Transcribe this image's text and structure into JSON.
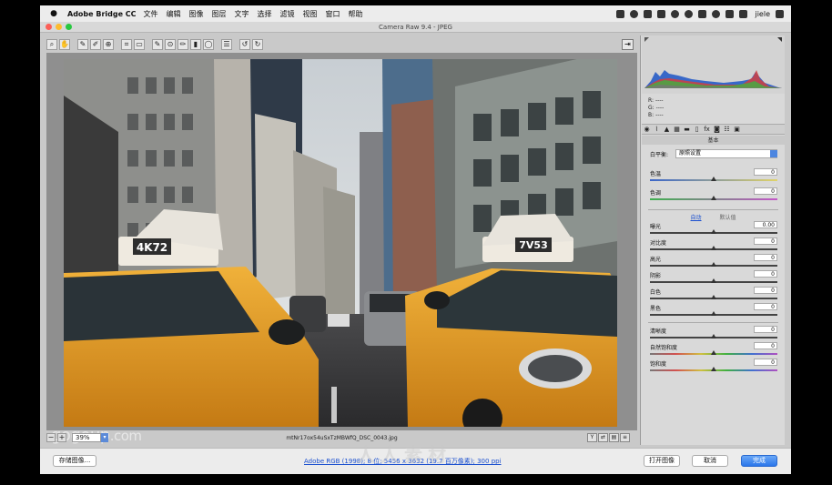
{
  "menubar": {
    "apple": "",
    "app_name": "Adobe Bridge CC",
    "items": [
      "文件",
      "编辑",
      "图像",
      "图层",
      "文字",
      "选择",
      "滤镜",
      "视图",
      "窗口",
      "帮助"
    ],
    "user": "jiele"
  },
  "window": {
    "title": "Camera Raw 9.4 - JPEG"
  },
  "toolbar": {
    "tools": [
      "zoom-tool-icon",
      "hand-tool-icon",
      "white-balance-icon",
      "color-sampler-icon",
      "target-adjust-icon",
      "crop-icon",
      "straighten-icon",
      "spot-removal-icon",
      "red-eye-icon",
      "adjustment-brush-icon",
      "graduated-filter-icon",
      "radial-filter-icon",
      "preferences-icon",
      "rotate-ccw-icon",
      "rotate-cw-icon"
    ],
    "toggle_fullscreen": "⇥"
  },
  "status": {
    "zoom_value": "39%",
    "filename": "mtNr17ox54uSxTzMBWfQ_DSC_0043.jpg"
  },
  "histogram": {
    "r_label": "R:",
    "r_value": "----",
    "g_label": "G:",
    "g_value": "----",
    "b_label": "B:",
    "b_value": "----"
  },
  "panel": {
    "section_title": "基本",
    "wb_label": "白平衡:",
    "wb_value": "原照设置",
    "temperature_label": "色温",
    "temperature_value": "0",
    "temperature_pos": 0.5,
    "tint_label": "色调",
    "tint_value": "0",
    "tint_pos": 0.5,
    "auto_label": "自动",
    "default_label": "默认值",
    "exposure_label": "曝光",
    "exposure_value": "0.00",
    "exposure_pos": 0.5,
    "contrast_label": "对比度",
    "contrast_value": "0",
    "contrast_pos": 0.5,
    "highlights_label": "高光",
    "highlights_value": "0",
    "highlights_pos": 0.5,
    "shadows_label": "阴影",
    "shadows_value": "0",
    "shadows_pos": 0.5,
    "whites_label": "白色",
    "whites_value": "0",
    "whites_pos": 0.5,
    "blacks_label": "黑色",
    "blacks_value": "0",
    "blacks_pos": 0.5,
    "clarity_label": "清晰度",
    "clarity_value": "0",
    "clarity_pos": 0.5,
    "vibrance_label": "自然饱和度",
    "vibrance_value": "0",
    "vibrance_pos": 0.5,
    "saturation_label": "饱和度",
    "saturation_value": "0",
    "saturation_pos": 0.5
  },
  "bottom": {
    "save_label": "存储图像...",
    "workflow_link": "Adobe RGB (1998); 8 位; 5456 x 3632 (19.7 百万像素); 300 ppi",
    "open_label": "打开图像",
    "cancel_label": "取消",
    "done_label": "完成"
  },
  "photo": {
    "taxi_left_sign": "4K72",
    "taxi_right_sign": "7V53"
  },
  "watermark": {
    "text": "gogoup",
    "suffix": ".com",
    "logo_text": "人人素材"
  }
}
